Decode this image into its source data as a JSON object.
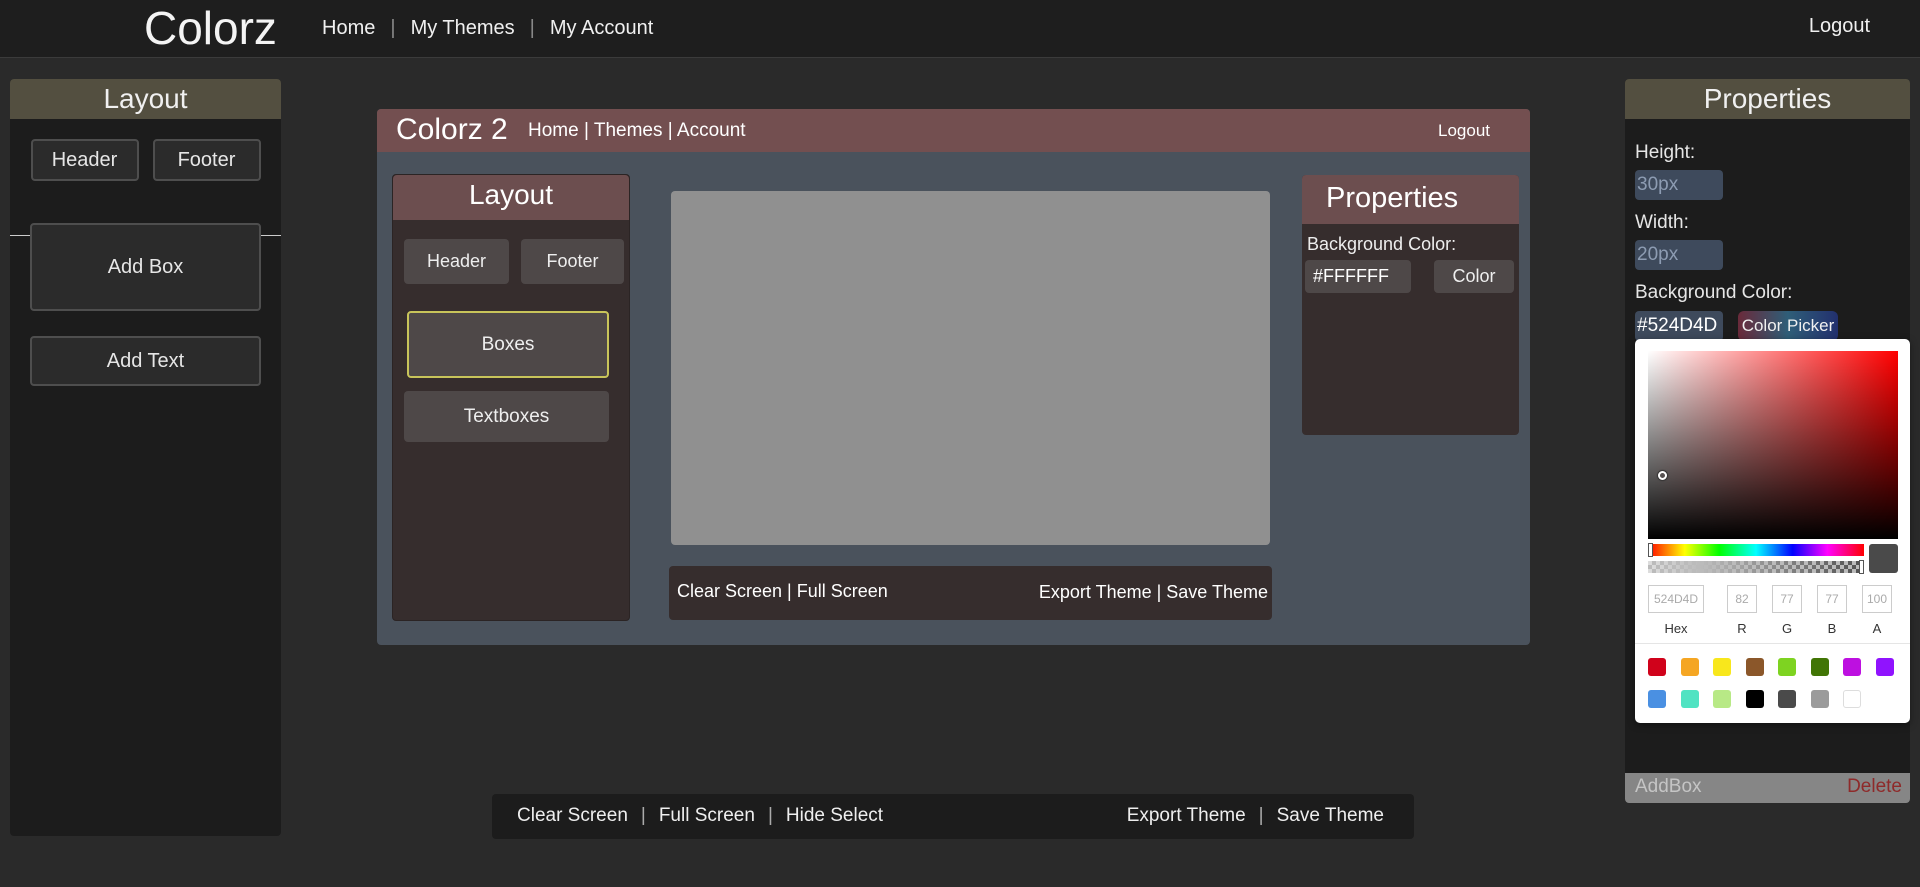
{
  "app": {
    "brand": "Colorz",
    "nav": [
      "Home",
      "My Themes",
      "My Account"
    ],
    "logout": "Logout"
  },
  "left_panel": {
    "title": "Layout",
    "tabs": [
      "Header",
      "Footer"
    ],
    "add_box": "Add Box",
    "add_text": "Add Text"
  },
  "preview": {
    "brand": "Colorz 2",
    "nav": "Home | Themes | Account",
    "logout": "Logout",
    "layout_title": "Layout",
    "tabs": [
      "Header",
      "Footer"
    ],
    "boxes": "Boxes",
    "textboxes": "Textboxes",
    "bottom_left": "Clear Screen | Full Screen",
    "bottom_right": "Export Theme  | Save Theme",
    "properties_title": "Properties",
    "bg_label": "Background Color:",
    "hex_value": "#FFFFFF",
    "color_button": "Color"
  },
  "properties": {
    "title": "Properties",
    "height_label": "Height:",
    "height_placeholder": "30px",
    "width_label": "Width:",
    "width_placeholder": "20px",
    "bg_label": "Background Color:",
    "bg_value": "#524D4D",
    "color_picker_label": "Color Picker",
    "add_box": "AddBox",
    "delete": "Delete"
  },
  "color_picker": {
    "hex": "524D4D",
    "r": "82",
    "g": "77",
    "b": "77",
    "a": "100",
    "labels": [
      "Hex",
      "R",
      "G",
      "B",
      "A"
    ],
    "swatches_row1": [
      "#d0021b",
      "#f5a623",
      "#f8e71c",
      "#8b572a",
      "#7ed321",
      "#417505",
      "#bd10e0",
      "#9013fe"
    ],
    "swatches_row2": [
      "#4a90e2",
      "#50e3c2",
      "#b8e986",
      "#000000",
      "#4a4a4a",
      "#9b9b9b",
      "#ffffff"
    ]
  },
  "bottom_bar": {
    "left": [
      "Clear Screen",
      "Full Screen",
      "Hide Select"
    ],
    "right": [
      "Export Theme",
      "Save Theme"
    ]
  }
}
